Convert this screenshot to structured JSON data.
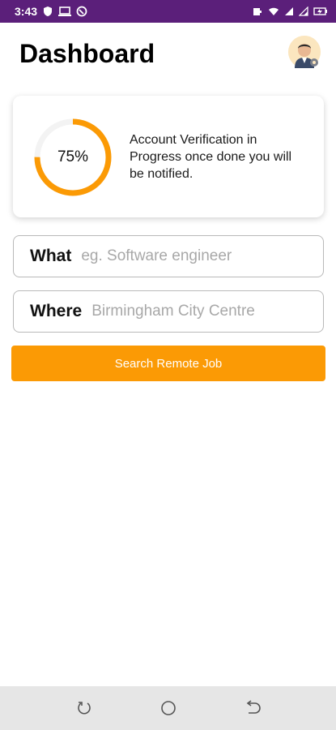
{
  "status_bar": {
    "time": "3:43",
    "left_icons": [
      "shield-icon",
      "monitor-icon",
      "sync-icon"
    ],
    "right_icons": [
      "battery-saver-icon",
      "wifi-icon",
      "signal-icon",
      "signal-icon",
      "charging-icon"
    ],
    "background_color": "#5b1f7a"
  },
  "header": {
    "title": "Dashboard",
    "avatar_icon": "user-avatar-icon"
  },
  "verification_card": {
    "progress_percent": 75,
    "progress_label": "75%",
    "message": "Account Verification in Progress once done you will be notified.",
    "accent_color": "#fb9a05"
  },
  "search": {
    "what_label": "What",
    "what_placeholder": "eg. Software engineer",
    "where_label": "Where",
    "where_value": "Birmingham City Centre",
    "button_label": "Search Remote Job"
  },
  "nav_bar": {
    "buttons": [
      "recent-apps-icon",
      "home-icon",
      "back-icon"
    ]
  }
}
